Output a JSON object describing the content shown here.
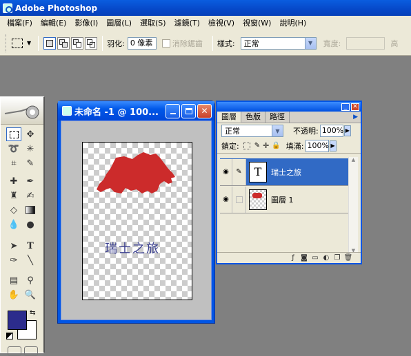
{
  "app": {
    "title": "Adobe Photoshop"
  },
  "menu": [
    "檔案(F)",
    "編輯(E)",
    "影像(I)",
    "圖層(L)",
    "選取(S)",
    "濾鏡(T)",
    "檢視(V)",
    "視窗(W)",
    "說明(H)"
  ],
  "options": {
    "feather_label": "羽化:",
    "feather_value": "0 像素",
    "antialias_label": "消除鋸齒",
    "style_label": "樣式:",
    "style_value": "正常",
    "width_label": "寬度:",
    "height_label": "高"
  },
  "document": {
    "title": "未命名 -1 @ 100...",
    "text_layer_content": "瑞士之旅",
    "shape_color": "#cc2b2b",
    "text_color": "#3a3f8f"
  },
  "layers_panel": {
    "tabs": [
      "圖層",
      "色版",
      "路徑"
    ],
    "blend_mode": "正常",
    "opacity_label": "不透明:",
    "opacity_value": "100%",
    "lock_label": "鎖定:",
    "fill_label": "填滿:",
    "fill_value": "100%",
    "layers": [
      {
        "name": "瑞士之旅",
        "type": "text",
        "thumb": "T",
        "selected": true
      },
      {
        "name": "圖層 1",
        "type": "pixel",
        "selected": false
      }
    ]
  },
  "colors": {
    "foreground": "#2c2c8c",
    "background": "#ffffff",
    "selection": "#316ac5"
  }
}
